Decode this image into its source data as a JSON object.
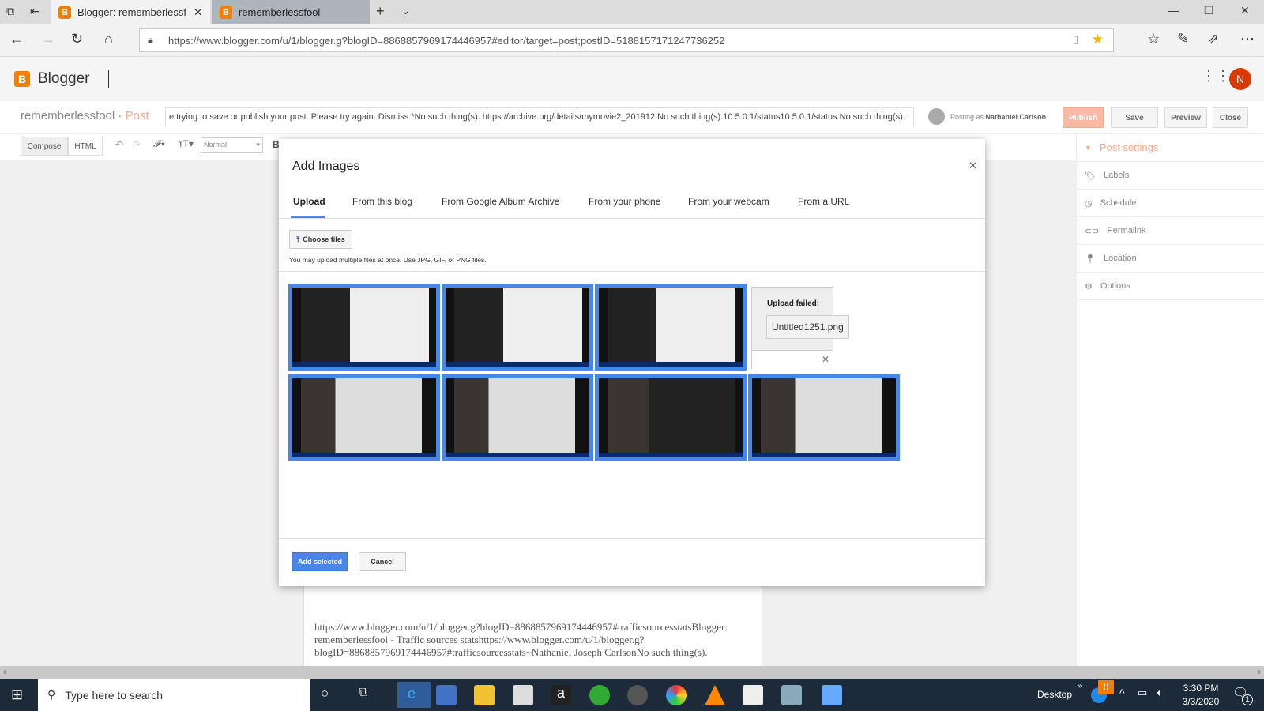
{
  "browser": {
    "tabs": [
      {
        "label": "Blogger: rememberlessf",
        "active": true
      },
      {
        "label": "rememberlessfool",
        "active": false
      }
    ],
    "url": "https://www.blogger.com/u/1/blogger.g?blogID=8868857969174446957#editor/target=post;postID=5188157171247736252"
  },
  "app": {
    "name": "Blogger",
    "avatar_letter": "N"
  },
  "post_header": {
    "blog": "rememberlessfool",
    "separator": " · ",
    "section": "Post",
    "title_value": "e trying to save or publish your post. Please try again. Dismiss *No such thing(s). https://archive.org/details/mymovie2_201912  No such thing(s).10.5.0.1/status10.5.0.1/status No such thing(s).",
    "posting_as_label": "Posting as",
    "user": "Nathaniel Carlson",
    "publish": "Publish",
    "save": "Save",
    "preview": "Preview",
    "close": "Close"
  },
  "toolbar": {
    "compose": "Compose",
    "html": "HTML",
    "format": "Normal"
  },
  "sidebar": {
    "title": "Post settings",
    "items": [
      {
        "label": "Labels",
        "icon": "tag-icon"
      },
      {
        "label": "Schedule",
        "icon": "clock-icon"
      },
      {
        "label": "Permalink",
        "icon": "link-icon"
      },
      {
        "label": "Location",
        "icon": "pin-icon"
      },
      {
        "label": "Options",
        "icon": "gear-icon"
      }
    ]
  },
  "dialog": {
    "title": "Add Images",
    "tabs": [
      "Upload",
      "From this blog",
      "From Google Album Archive",
      "From your phone",
      "From your webcam",
      "From a URL"
    ],
    "choose_files": "Choose files",
    "hint": "You may upload multiple files at once. Use JPG, GIF, or PNG files.",
    "failed_label": "Upload failed:",
    "failed_file": "Untitled1251.png",
    "add_selected": "Add selected",
    "cancel": "Cancel",
    "accent": "#4a86e8"
  },
  "editor_text": "https://www.blogger.com/u/1/blogger.g?blogID=8868857969174446957#trafficsourcesstatsBlogger: rememberlessfool - Traffic sources statshttps://www.blogger.com/u/1/blogger.g?blogID=8868857969174446957#trafficsourcesstats~Nathaniel Joseph CarlsonNo such thing(s).",
  "taskbar": {
    "search_placeholder": "Type here to search",
    "desktop": "Desktop",
    "time": "3:30 PM",
    "date": "3/3/2020",
    "notifications": "1"
  }
}
